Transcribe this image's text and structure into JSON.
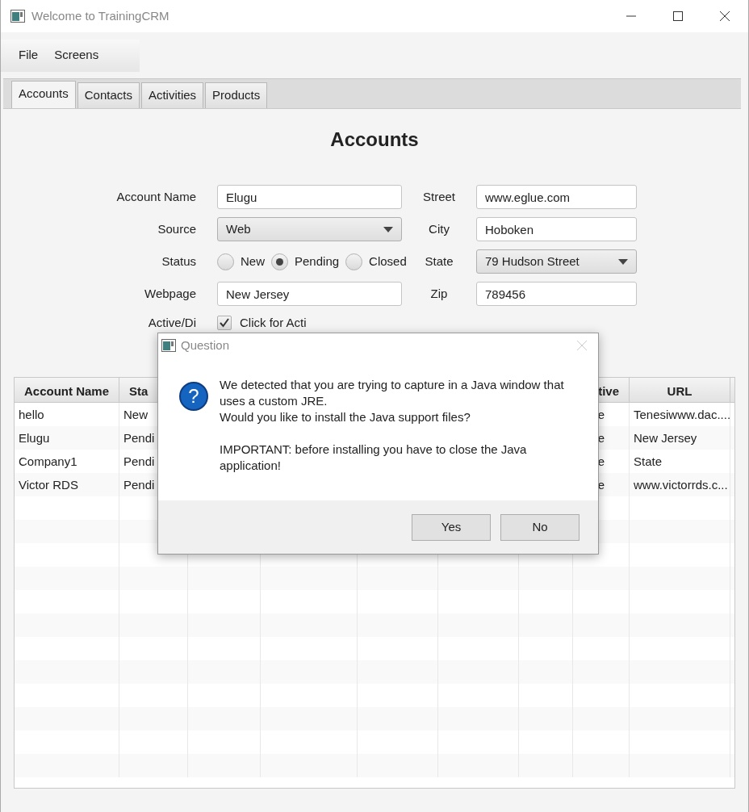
{
  "window": {
    "title": "Welcome to TrainingCRM"
  },
  "menu": [
    "File",
    "Screens"
  ],
  "tabs": [
    {
      "label": "Accounts",
      "selected": true
    },
    {
      "label": "Contacts",
      "selected": false
    },
    {
      "label": "Activities",
      "selected": false
    },
    {
      "label": "Products",
      "selected": false
    }
  ],
  "heading": "Accounts",
  "form": {
    "account_name": {
      "label": "Account Name",
      "value": "Elugu"
    },
    "source": {
      "label": "Source",
      "value": "Web"
    },
    "status": {
      "label": "Status",
      "options": [
        {
          "label": "New",
          "selected": false
        },
        {
          "label": "Pending",
          "selected": true
        },
        {
          "label": "Closed",
          "selected": false
        }
      ]
    },
    "webpage": {
      "label": "Webpage",
      "value": "New Jersey"
    },
    "active": {
      "label": "Active/Di",
      "checkbox_label": "Click for Acti",
      "checked": true
    },
    "street": {
      "label": "Street",
      "value": "www.eglue.com"
    },
    "city": {
      "label": "City",
      "value": "Hoboken"
    },
    "state": {
      "label": "State",
      "value": "79 Hudson Street"
    },
    "zip": {
      "label": "Zip",
      "value": "789456"
    }
  },
  "table": {
    "columns": [
      "Account Name",
      "Sta",
      "tive",
      "URL"
    ],
    "rows": [
      [
        "hello",
        "New",
        "e",
        "Tenesiwww.dac...."
      ],
      [
        "Elugu",
        "Pendi",
        "e",
        "New Jersey"
      ],
      [
        "Company1",
        "Pendi",
        "e",
        "State"
      ],
      [
        "Victor RDS",
        "Pendi",
        "e",
        "www.victorrds.c..."
      ]
    ]
  },
  "dialog": {
    "title": "Question",
    "icon_text": "?",
    "message": [
      "We detected that you are trying to capture in a Java window that uses a custom JRE.",
      "Would you like to install the Java support files?",
      "IMPORTANT: before installing you have to close the Java application!"
    ],
    "buttons": [
      "Yes",
      "No"
    ]
  }
}
